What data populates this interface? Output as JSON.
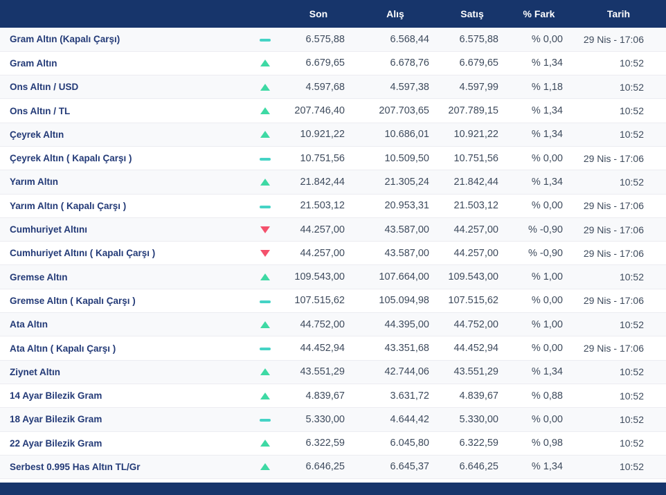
{
  "colors": {
    "header_navy": "#17356b",
    "name_blue": "#233a77",
    "value_gray": "#3d4a5c",
    "trend_up_green": "#3ed9a4",
    "trend_down_red": "#f4516c",
    "trend_flat_teal": "#45d3c5"
  },
  "table": {
    "columns": {
      "name": "",
      "trend": "",
      "son": "Son",
      "alis": "Alış",
      "satis": "Satış",
      "fark": "% Fark",
      "tarih": "Tarih"
    },
    "rows": [
      {
        "name": "Gram Altın (Kapalı Çarşı)",
        "trend": "flat",
        "son": "6.575,88",
        "alis": "6.568,44",
        "satis": "6.575,88",
        "fark": "% 0,00",
        "tarih": "29 Nis - 17:06"
      },
      {
        "name": "Gram Altın",
        "trend": "up",
        "son": "6.679,65",
        "alis": "6.678,76",
        "satis": "6.679,65",
        "fark": "% 1,34",
        "tarih": "10:52"
      },
      {
        "name": "Ons Altın / USD",
        "trend": "up",
        "son": "4.597,68",
        "alis": "4.597,38",
        "satis": "4.597,99",
        "fark": "% 1,18",
        "tarih": "10:52"
      },
      {
        "name": "Ons Altın / TL",
        "trend": "up",
        "son": "207.746,40",
        "alis": "207.703,65",
        "satis": "207.789,15",
        "fark": "% 1,34",
        "tarih": "10:52"
      },
      {
        "name": "Çeyrek Altın",
        "trend": "up",
        "son": "10.921,22",
        "alis": "10.686,01",
        "satis": "10.921,22",
        "fark": "% 1,34",
        "tarih": "10:52"
      },
      {
        "name": "Çeyrek Altın ( Kapalı Çarşı )",
        "trend": "flat",
        "son": "10.751,56",
        "alis": "10.509,50",
        "satis": "10.751,56",
        "fark": "% 0,00",
        "tarih": "29 Nis - 17:06"
      },
      {
        "name": "Yarım Altın",
        "trend": "up",
        "son": "21.842,44",
        "alis": "21.305,24",
        "satis": "21.842,44",
        "fark": "% 1,34",
        "tarih": "10:52"
      },
      {
        "name": "Yarım Altın ( Kapalı Çarşı )",
        "trend": "flat",
        "son": "21.503,12",
        "alis": "20.953,31",
        "satis": "21.503,12",
        "fark": "% 0,00",
        "tarih": "29 Nis - 17:06"
      },
      {
        "name": "Cumhuriyet Altını",
        "trend": "down",
        "son": "44.257,00",
        "alis": "43.587,00",
        "satis": "44.257,00",
        "fark": "% -0,90",
        "tarih": "29 Nis - 17:06"
      },
      {
        "name": "Cumhuriyet Altını ( Kapalı Çarşı )",
        "trend": "down",
        "son": "44.257,00",
        "alis": "43.587,00",
        "satis": "44.257,00",
        "fark": "% -0,90",
        "tarih": "29 Nis - 17:06"
      },
      {
        "name": "Gremse Altın",
        "trend": "up",
        "son": "109.543,00",
        "alis": "107.664,00",
        "satis": "109.543,00",
        "fark": "% 1,00",
        "tarih": "10:52"
      },
      {
        "name": "Gremse Altın ( Kapalı Çarşı )",
        "trend": "flat",
        "son": "107.515,62",
        "alis": "105.094,98",
        "satis": "107.515,62",
        "fark": "% 0,00",
        "tarih": "29 Nis - 17:06"
      },
      {
        "name": "Ata Altın",
        "trend": "up",
        "son": "44.752,00",
        "alis": "44.395,00",
        "satis": "44.752,00",
        "fark": "% 1,00",
        "tarih": "10:52"
      },
      {
        "name": "Ata Altın ( Kapalı Çarşı )",
        "trend": "flat",
        "son": "44.452,94",
        "alis": "43.351,68",
        "satis": "44.452,94",
        "fark": "% 0,00",
        "tarih": "29 Nis - 17:06"
      },
      {
        "name": "Ziynet Altın",
        "trend": "up",
        "son": "43.551,29",
        "alis": "42.744,06",
        "satis": "43.551,29",
        "fark": "% 1,34",
        "tarih": "10:52"
      },
      {
        "name": "14 Ayar Bilezik Gram",
        "trend": "up",
        "son": "4.839,67",
        "alis": "3.631,72",
        "satis": "4.839,67",
        "fark": "% 0,88",
        "tarih": "10:52"
      },
      {
        "name": "18 Ayar Bilezik Gram",
        "trend": "flat",
        "son": "5.330,00",
        "alis": "4.644,42",
        "satis": "5.330,00",
        "fark": "% 0,00",
        "tarih": "10:52"
      },
      {
        "name": "22 Ayar Bilezik Gram",
        "trend": "up",
        "son": "6.322,59",
        "alis": "6.045,80",
        "satis": "6.322,59",
        "fark": "% 0,98",
        "tarih": "10:52"
      },
      {
        "name": "Serbest 0.995 Has Altın TL/Gr",
        "trend": "up",
        "son": "6.646,25",
        "alis": "6.645,37",
        "satis": "6.646,25",
        "fark": "% 1,34",
        "tarih": "10:52"
      }
    ]
  }
}
